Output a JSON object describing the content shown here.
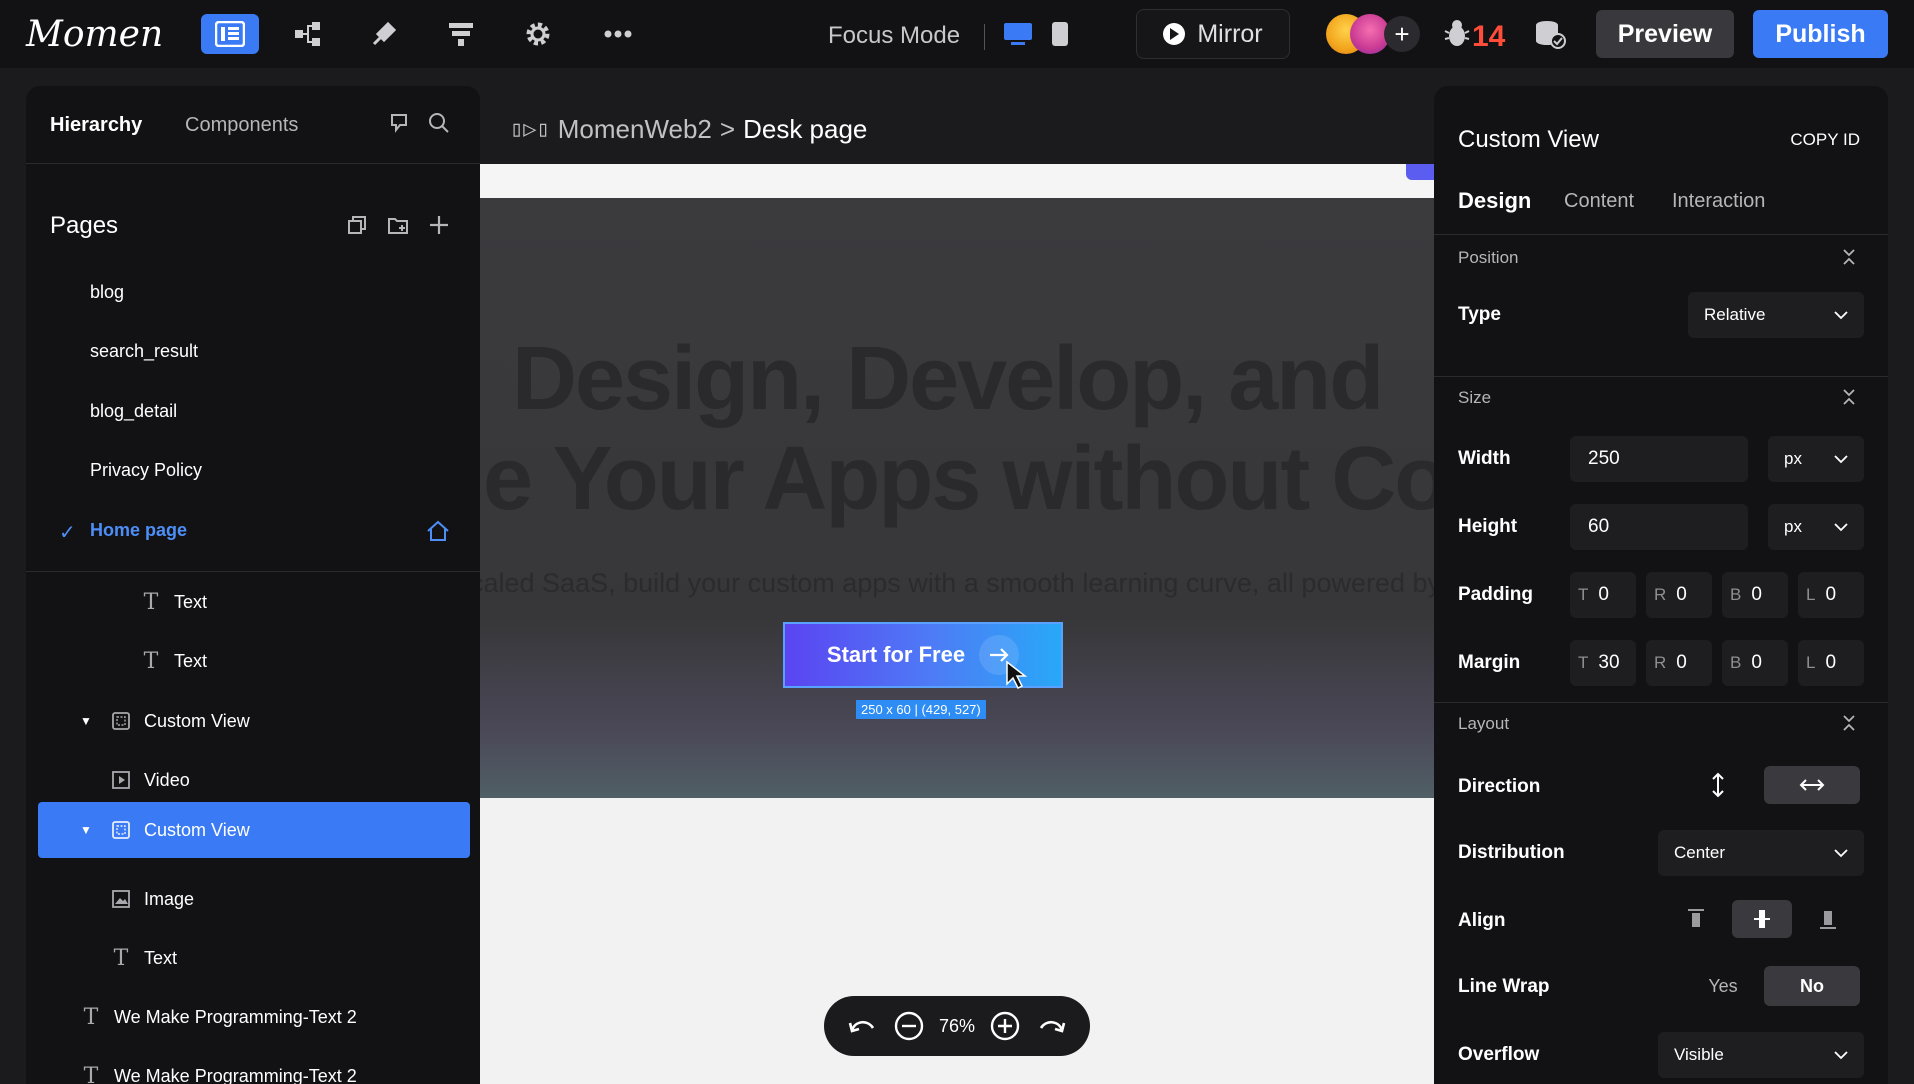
{
  "topbar": {
    "logo_text": "Momen",
    "focus_mode_label": "Focus Mode",
    "mirror_label": "Mirror",
    "bug_count": "14",
    "preview_label": "Preview",
    "publish_label": "Publish",
    "accent_color": "#3a7bf5"
  },
  "left_panel": {
    "tabs": [
      "Hierarchy",
      "Components"
    ],
    "pages_title": "Pages",
    "pages": [
      "blog",
      "search_result",
      "blog_detail",
      "Privacy Policy",
      "Home page"
    ],
    "tree": [
      {
        "label": "Text",
        "icon": "text-icon"
      },
      {
        "label": "Text",
        "icon": "text-icon"
      },
      {
        "label": "Custom View",
        "icon": "custom-view-icon"
      },
      {
        "label": "Video",
        "icon": "video-icon"
      },
      {
        "label": "Custom View",
        "icon": "custom-view-icon"
      },
      {
        "label": "Image",
        "icon": "image-icon"
      },
      {
        "label": "Text",
        "icon": "text-icon"
      },
      {
        "label": "We Make Programming-Text 2",
        "icon": "text-icon"
      },
      {
        "label": "We Make Programming-Text 2",
        "icon": "text-icon"
      }
    ]
  },
  "canvas": {
    "breadcrumb_project": "MomenWeb2",
    "breadcrumb_separator": ">",
    "breadcrumb_page": "Desk page",
    "hero_line1": "Design, Develop, and",
    "hero_line2": "le Your Apps without Coc",
    "hero_sub": "caled SaaS, build your custom apps with a smooth learning curve, all powered by M",
    "cta_label": "Start for Free",
    "size_badge": "250 x 60 | (429, 527)",
    "zoom": "76%"
  },
  "right_panel": {
    "title": "Custom View",
    "copy_id": "COPY ID",
    "tabs": [
      "Design",
      "Content",
      "Interaction"
    ],
    "position": {
      "section": "Position",
      "type_label": "Type",
      "type_value": "Relative"
    },
    "size": {
      "section": "Size",
      "width_label": "Width",
      "width_value": "250",
      "width_unit": "px",
      "height_label": "Height",
      "height_value": "60",
      "height_unit": "px",
      "padding_label": "Padding",
      "padding": {
        "T": "0",
        "R": "0",
        "B": "0",
        "L": "0"
      },
      "margin_label": "Margin",
      "margin": {
        "T": "30",
        "R": "0",
        "B": "0",
        "L": "0"
      }
    },
    "layout": {
      "section": "Layout",
      "direction_label": "Direction",
      "distribution_label": "Distribution",
      "distribution_value": "Center",
      "align_label": "Align",
      "line_wrap_label": "Line Wrap",
      "line_wrap_yes": "Yes",
      "line_wrap_no": "No",
      "overflow_label": "Overflow",
      "overflow_value": "Visible"
    }
  }
}
